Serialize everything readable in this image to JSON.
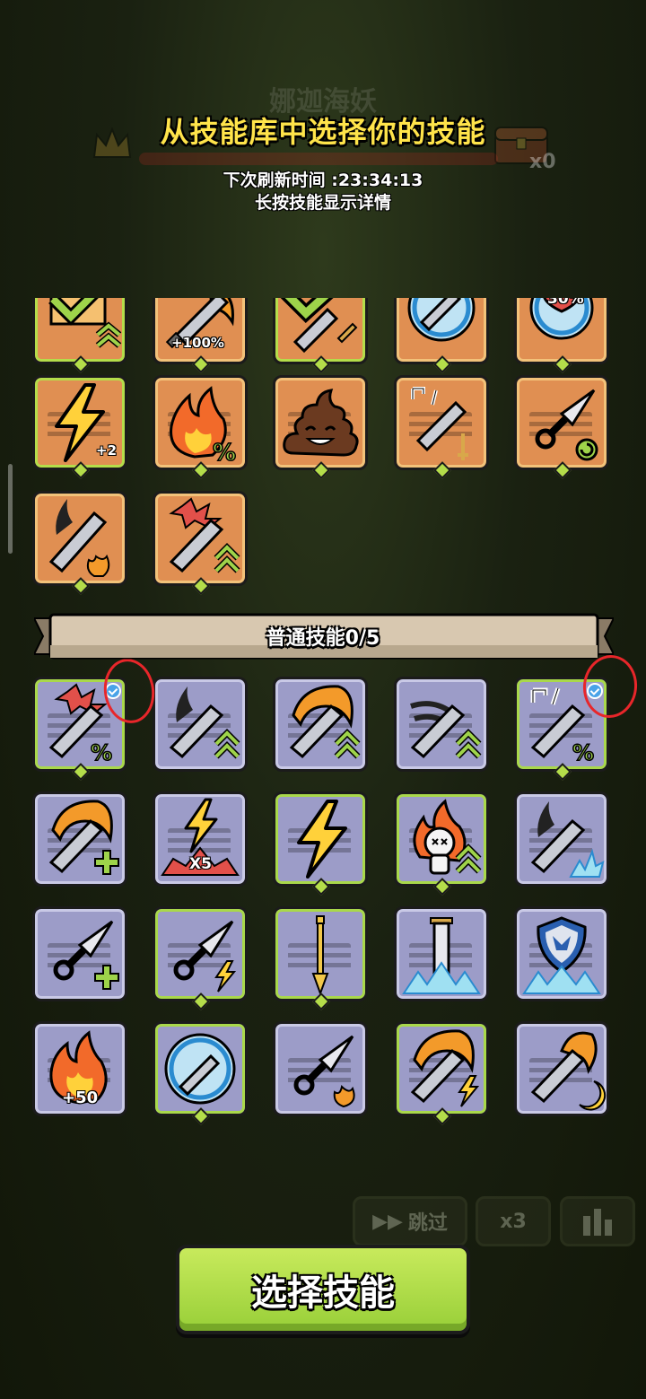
{
  "background": {
    "boss_name": "娜迦海妖",
    "reward_count": "x0"
  },
  "header": {
    "title": "从技能库中选择你的技能",
    "refresh_label": "下次刷新时间 :23:34:13",
    "hint": "长按技能显示详情"
  },
  "special_skills": [
    {
      "icon": "check-upgrade-icon",
      "badge": ""
    },
    {
      "icon": "sword-fire-icon",
      "badge": "+100%"
    },
    {
      "icon": "check-sword-icon",
      "badge": ""
    },
    {
      "icon": "sword-shield-orb-icon",
      "badge": ""
    },
    {
      "icon": "heart-percent-icon",
      "badge": "30%"
    },
    {
      "icon": "lightning-icon",
      "badge": "+2"
    },
    {
      "icon": "fire-percent-icon",
      "badge": ""
    },
    {
      "icon": "poop-icon",
      "badge": ""
    },
    {
      "icon": "sword-split-icon",
      "badge": ""
    },
    {
      "icon": "kunai-return-icon",
      "badge": ""
    },
    {
      "icon": "sword-slash-fire-icon",
      "badge": ""
    },
    {
      "icon": "sword-burst-up-icon",
      "badge": ""
    }
  ],
  "section": {
    "normal_label": "普通技能0/5"
  },
  "normal_skills": [
    {
      "icon": "sword-burst-percent-icon",
      "badge": "",
      "selected": true
    },
    {
      "icon": "sword-slash-up-icon",
      "badge": ""
    },
    {
      "icon": "sword-flame-up-icon",
      "badge": ""
    },
    {
      "icon": "sword-wind-up-icon",
      "badge": ""
    },
    {
      "icon": "sword-split-percent-icon",
      "badge": "",
      "selected": true
    },
    {
      "icon": "sword-flame-plus-icon",
      "badge": ""
    },
    {
      "icon": "lightning-x5-icon",
      "badge": "X5"
    },
    {
      "icon": "lightning-icon",
      "badge": ""
    },
    {
      "icon": "doll-fire-icon",
      "badge": ""
    },
    {
      "icon": "sword-slash-ice-icon",
      "badge": ""
    },
    {
      "icon": "kunai-plus-icon",
      "badge": ""
    },
    {
      "icon": "kunai-lightning-icon",
      "badge": ""
    },
    {
      "icon": "golden-staff-icon",
      "badge": ""
    },
    {
      "icon": "sword-in-ice-icon",
      "badge": ""
    },
    {
      "icon": "shield-ice-icon",
      "badge": ""
    },
    {
      "icon": "fire-plus50-icon",
      "badge": "+50"
    },
    {
      "icon": "sword-orb-icon",
      "badge": ""
    },
    {
      "icon": "kunai-fire-icon",
      "badge": ""
    },
    {
      "icon": "sword-flame-lightning-icon",
      "badge": ""
    },
    {
      "icon": "sword-flame-moon-icon",
      "badge": ""
    }
  ],
  "controls": {
    "skip_label": "跳过",
    "speed_label": "x3"
  },
  "select_button": {
    "label": "选择技能"
  },
  "colors": {
    "title_yellow": "#ffe44a",
    "green_button": "#a8d84a",
    "special_tile": "#e08f52",
    "normal_tile": "#9c9cc8",
    "selected_check": "#4aa3e8",
    "annotation_red": "#e8262a"
  }
}
